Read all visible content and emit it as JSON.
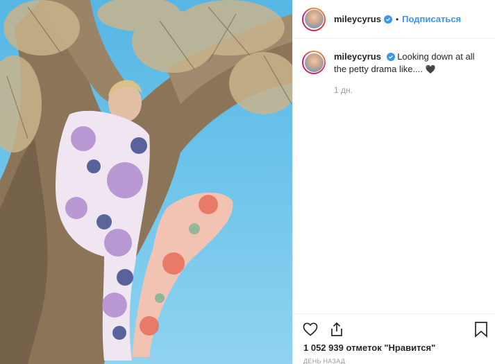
{
  "post": {
    "username": "mileycyrus",
    "follow_label": "Подписаться",
    "separator": "•",
    "caption": "Looking down at all the petty drama like.... ",
    "caption_emoji": "🖤",
    "comment_time": "1 дн.",
    "likes_text": "1 052 939 отметок \"Нравится\"",
    "posted_ago": "ДЕНЬ НАЗАД"
  },
  "colors": {
    "accent": "#3897f0",
    "sky": "#6cc3ea",
    "text": "#262626",
    "muted": "#999999"
  },
  "icons": {
    "verified": "verified-badge-icon",
    "like": "heart-outline-icon",
    "share": "share-icon",
    "save": "bookmark-icon"
  }
}
